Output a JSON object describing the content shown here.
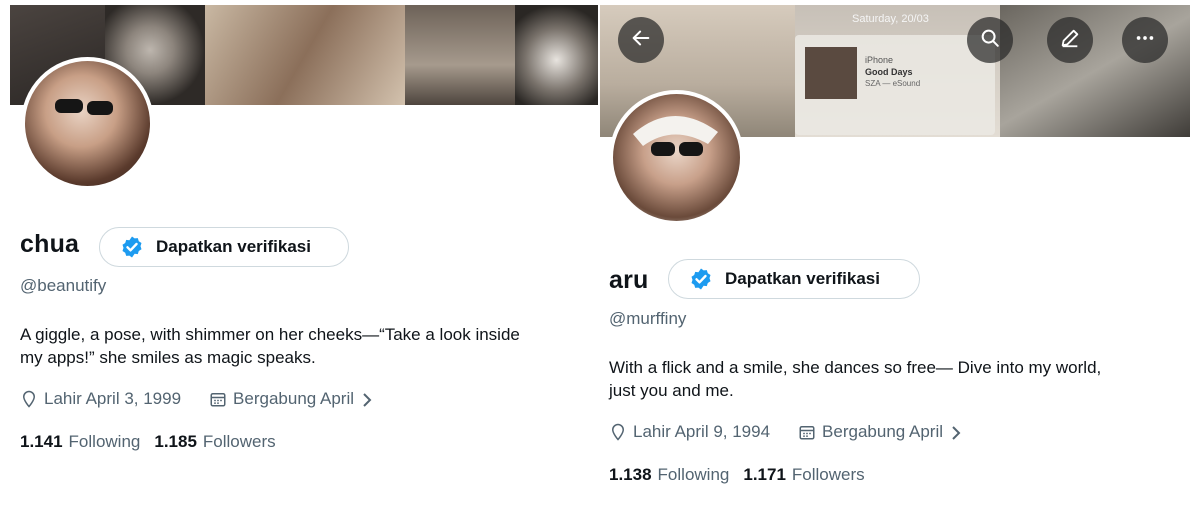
{
  "profiles": [
    {
      "name": "chua",
      "verify_label": "Dapatkan verifikasi",
      "handle": "@beanutify",
      "bio_line1": "A giggle, a pose, with shimmer on her cheeks—“Take a look inside",
      "bio_line2": "my apps!” she smiles as magic speaks.",
      "birth": "Lahir April 3, 1999",
      "joined": "Bergabung April",
      "following_count": "1.141",
      "following_label": "Following",
      "followers_count": "1.185",
      "followers_label": "Followers"
    },
    {
      "name": "aru",
      "verify_label": "Dapatkan verifikasi",
      "handle": "@murffiny",
      "bio_line1": "With a flick and a smile, she dances so free— Dive into my world,",
      "bio_line2": "just you and me.",
      "birth": "Lahir April 9, 1994",
      "joined": "Bergabung April",
      "following_count": "1.138",
      "following_label": "Following",
      "followers_count": "1.171",
      "followers_label": "Followers",
      "banner_date": "Saturday, 20/03",
      "now_playing": {
        "label": "iPhone",
        "title": "Good Days",
        "artist": "SZA — eSound"
      }
    }
  ],
  "icons": [
    "back-arrow-icon",
    "search-icon",
    "edit-icon",
    "more-icon",
    "verified-check-icon",
    "location-icon",
    "calendar-icon",
    "chevron-right-icon"
  ],
  "colors": {
    "accent": "#1d9bf0",
    "text": "#0f1419",
    "secondary": "#536471",
    "border": "#cfd9de"
  }
}
